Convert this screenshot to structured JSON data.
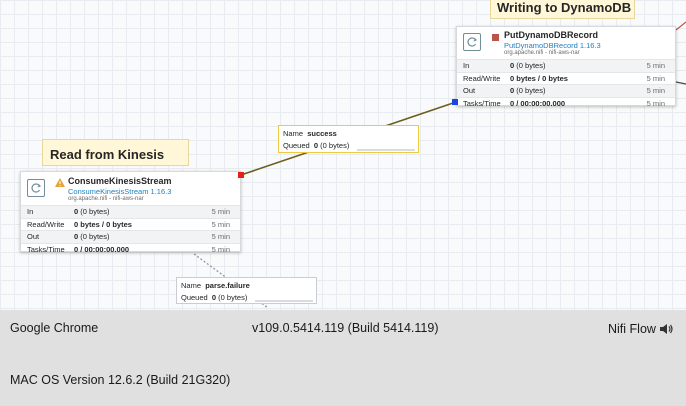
{
  "canvas": {
    "labels": {
      "kinesis": "Read from Kinesis",
      "dynamo": "Writing to DynamoDB"
    },
    "consume": {
      "name": "ConsumeKinesisStream",
      "type": "ConsumeKinesisStream 1.16.3",
      "bundle": "org.apache.nifi - nifi-aws-nar",
      "warning": true,
      "stats": [
        {
          "key": "In",
          "value": "0",
          "detail": "(0 bytes)",
          "time": "5 min"
        },
        {
          "key": "Read/Write",
          "value": "0 bytes / 0 bytes",
          "detail": "",
          "time": "5 min"
        },
        {
          "key": "Out",
          "value": "0",
          "detail": "(0 bytes)",
          "time": "5 min"
        },
        {
          "key": "Tasks/Time",
          "value": "0 / 00:00:00.000",
          "detail": "",
          "time": "5 min"
        }
      ]
    },
    "put": {
      "name": "PutDynamoDBRecord",
      "type": "PutDynamoDBRecord 1.16.3",
      "bundle": "org.apache.nifi - nifi-aws-nar",
      "stopped": true,
      "stats": [
        {
          "key": "In",
          "value": "0",
          "detail": "(0 bytes)",
          "time": "5 min"
        },
        {
          "key": "Read/Write",
          "value": "0 bytes / 0 bytes",
          "detail": "",
          "time": "5 min"
        },
        {
          "key": "Out",
          "value": "0",
          "detail": "(0 bytes)",
          "time": "5 min"
        },
        {
          "key": "Tasks/Time",
          "value": "0 / 00:00:00.000",
          "detail": "",
          "time": "5 min"
        }
      ]
    },
    "connections": {
      "success": {
        "name_label": "Name",
        "name": "success",
        "queued_label": "Queued",
        "queued": "0",
        "queued_detail": "(0 bytes)"
      },
      "failure": {
        "name_label": "Name",
        "name": "parse.failure",
        "queued_label": "Queued",
        "queued": "0",
        "queued_detail": "(0 bytes)"
      }
    }
  },
  "info_bar": {
    "browser": "Google Chrome",
    "version": "v109.0.5414.119 (Build 5414.119)",
    "app": "Nifi Flow",
    "app_icon": "speaker-icon",
    "os": "MAC OS Version 12.6.2 (Build 21G320)"
  },
  "colors": {
    "label_bg": "#fff7d7",
    "stopped": "#ba554a",
    "warning": "#e6a23c",
    "success_line": "#6d5d1c",
    "port_red": "#e81e1e",
    "port_blue": "#1a45e6",
    "selected_border": "#efc944"
  }
}
